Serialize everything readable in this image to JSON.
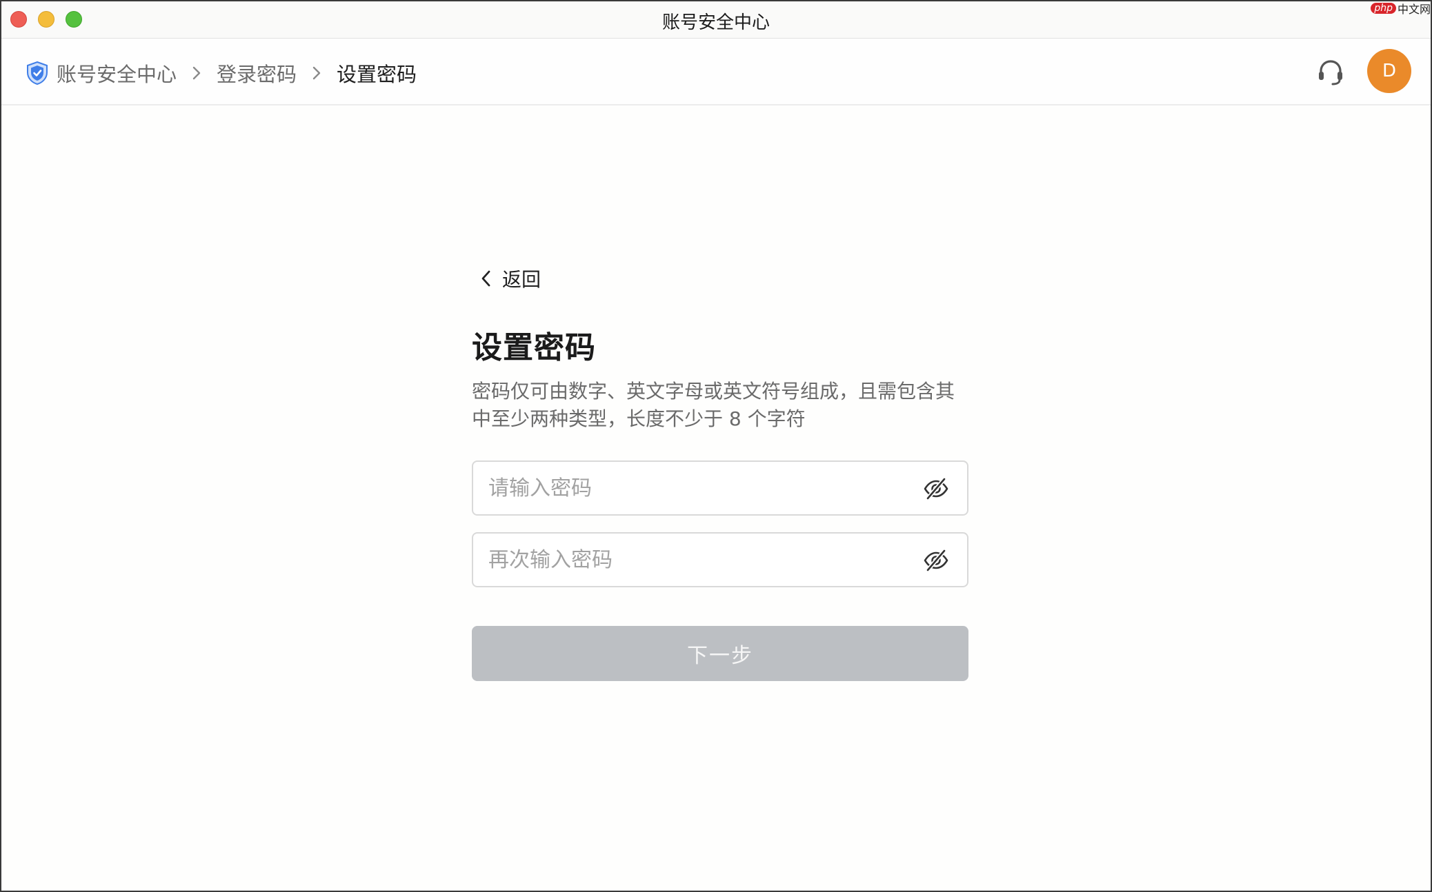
{
  "window": {
    "title": "账号安全中心"
  },
  "watermark": {
    "badge": "php",
    "text": "中文网"
  },
  "breadcrumb": {
    "items": [
      {
        "label": "账号安全中心"
      },
      {
        "label": "登录密码"
      },
      {
        "label": "设置密码"
      }
    ],
    "icon": "shield-check-icon"
  },
  "header_actions": {
    "support_icon": "headset-icon",
    "avatar_initial": "D"
  },
  "form": {
    "back_label": "返回",
    "title": "设置密码",
    "description": "密码仅可由数字、英文字母或英文符号组成，且需包含其中至少两种类型，长度不少于 8 个字符",
    "password_placeholder": "请输入密码",
    "confirm_placeholder": "再次输入密码",
    "password_value": "",
    "confirm_value": "",
    "visibility_icon": "eye-off-icon",
    "submit_label": "下一步",
    "submit_enabled": false
  },
  "colors": {
    "accent_shield": "#3f7ee8",
    "avatar_bg": "#ea8a2a",
    "button_disabled": "#bcbfc3",
    "close": "#ee5e55",
    "minimize": "#f4bd3b",
    "maximize": "#55c13f"
  }
}
